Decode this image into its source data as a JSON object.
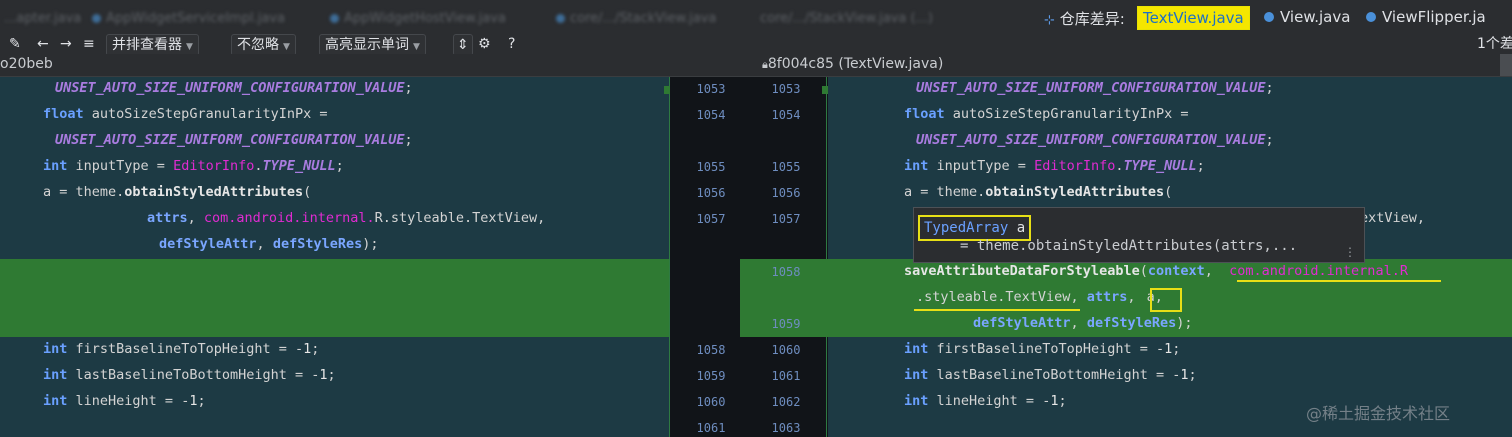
{
  "tabs": {
    "ghost": [
      "...apter.java",
      "AppWidgetServiceImpl.java",
      "AppWidgetHostView.java",
      "core/.../StackView.java",
      "core/.../StackView.java (...)"
    ],
    "diff_label": "仓库差异:",
    "active": "TextView.java",
    "view": "View.java",
    "flipper": "ViewFlipper.ja"
  },
  "toolbar": {
    "viewer": "并排查看器",
    "ignore": "不忽略",
    "highlight": "高亮显示单词",
    "help": "?",
    "count": "1个差"
  },
  "path": {
    "left": "o20beb",
    "right": "8f004c85 (TextView.java)"
  },
  "line_numbers": {
    "left": [
      "1053",
      "1054",
      "1055",
      "1056",
      "1057",
      "1058",
      "1059",
      "1060",
      "1061"
    ],
    "right": [
      "1053",
      "1054",
      "1055",
      "1056",
      "1057",
      "1058",
      "1059",
      "1060",
      "1061",
      "1062",
      "1063"
    ]
  },
  "code_left": [
    "UNSET_AUTO_SIZE_UNIFORM_CONFIGURATION_VALUE",
    "float",
    "autoSizeStepGranularityInPx =",
    "UNSET_AUTO_SIZE_UNIFORM_CONFIGURATION_VALUE",
    "int",
    "inputType = ",
    "EditorInfo",
    "TYPE_NULL",
    "a = theme.",
    "obtainStyledAttributes",
    "attrs",
    "com.android.internal.",
    "R.styleable.TextView,",
    "defStyleAttr",
    "defStyleRes",
    "firstBaselineToTopHeight = -",
    "lastBaselineToBottomHeight = -",
    "lineHeight = -",
    "1"
  ],
  "code_right": [
    "saveAttributeDataForStyleable",
    "context",
    "com.android.internal.R",
    ".styleable.TextView",
    "a,"
  ],
  "tooltip": {
    "type": "TypedArray",
    "name": "a",
    "line2": "= theme.obtainStyledAttributes(attrs,...",
    "more": "⋮"
  },
  "watermark": "@稀土掘金技术社区",
  "colors": {
    "highlight": "#e7df16",
    "added": "#2f7a33",
    "pane": "#1d3a44",
    "keyword": "#6aa0ff",
    "constant": "#a97ce0",
    "package": "#e02bd1"
  }
}
